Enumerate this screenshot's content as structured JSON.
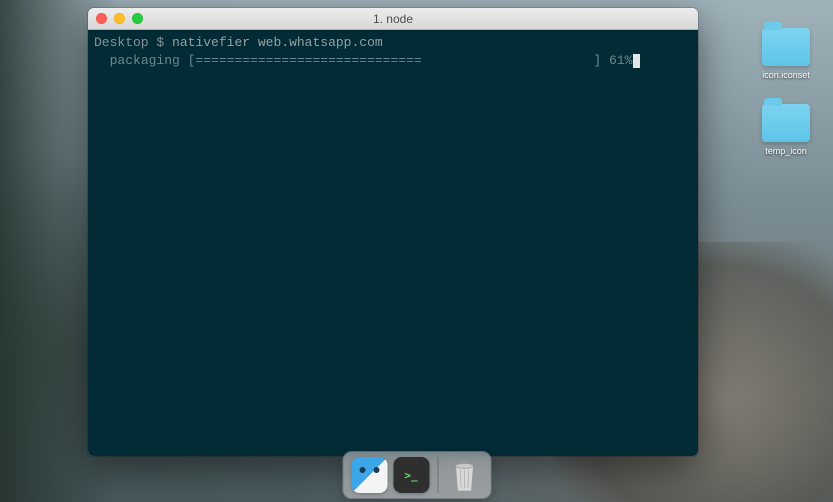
{
  "window": {
    "title": "1. node"
  },
  "terminal": {
    "prompt_path": "Desktop",
    "prompt_symbol": "$",
    "command": "nativefier web.whatsapp.com",
    "progress_label": "packaging",
    "progress_bar_open": "[",
    "progress_bar_fill": "=============================",
    "progress_bar_close": "]",
    "progress_percent": "61%"
  },
  "desktop_icons": [
    {
      "label": "icon.iconset"
    },
    {
      "label": "temp_icon"
    }
  ],
  "dock": {
    "terminal_glyph": ">_"
  }
}
